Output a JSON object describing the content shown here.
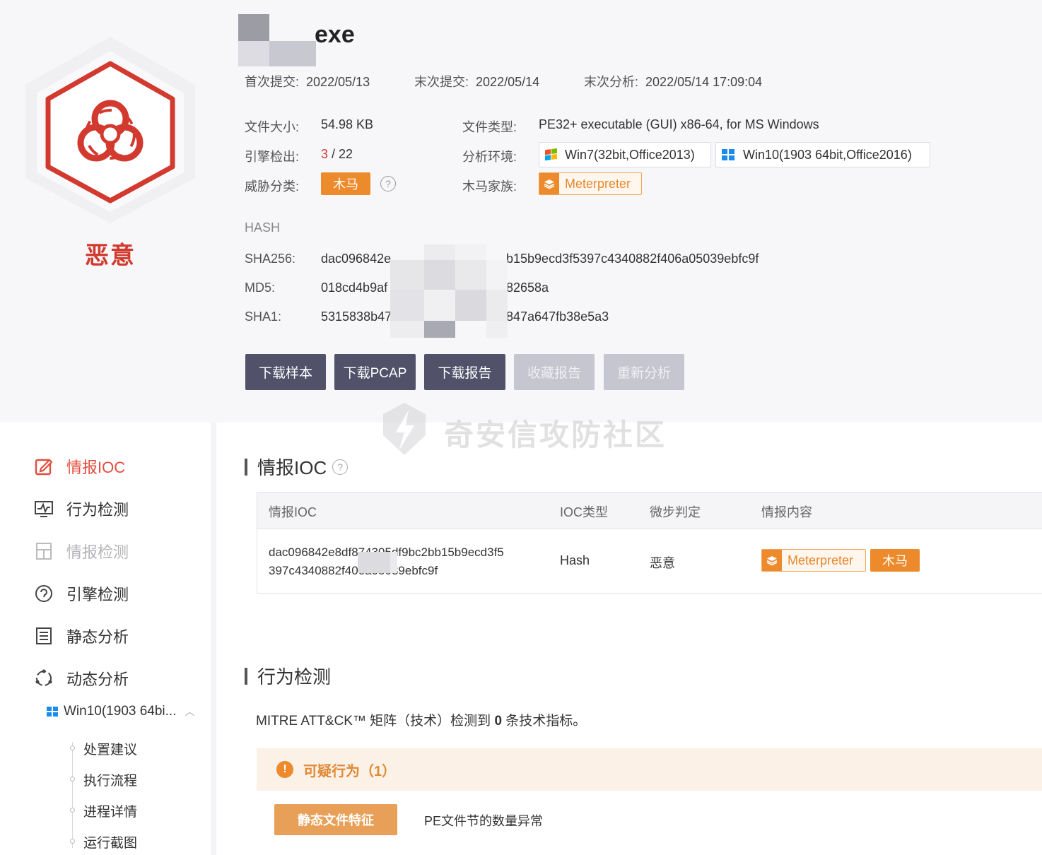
{
  "file": {
    "name_ext": "exe",
    "verdict": "恶意"
  },
  "dates": {
    "first_submit_label": "首次提交:",
    "first_submit_value": "2022/05/13",
    "last_submit_label": "末次提交:",
    "last_submit_value": "2022/05/14",
    "last_analysis_label": "末次分析:",
    "last_analysis_value": "2022/05/14 17:09:04"
  },
  "info": {
    "size_label": "文件大小:",
    "size_value": "54.98 KB",
    "type_label": "文件类型:",
    "type_value": "PE32+ executable (GUI) x86-64, for MS Windows",
    "engine_label": "引擎检出:",
    "engine_hits": "3",
    "engine_total": " / 22",
    "env_label": "分析环境:",
    "env_win7": "Win7(32bit,Office2013)",
    "env_win10": "Win10(1903 64bit,Office2016)",
    "threat_label": "威胁分类:",
    "threat_tag": "木马",
    "family_label": "木马家族:",
    "family_tag": "Meterpreter"
  },
  "hash": {
    "heading": "HASH",
    "sha256_label": "SHA256:",
    "sha256_left": "dac096842e",
    "sha256_right": "b15b9ecd3f5397c4340882f406a05039ebfc9f",
    "md5_label": "MD5:",
    "md5_left": "018cd4b9af",
    "md5_right": "82658a",
    "sha1_label": "SHA1:",
    "sha1_left": "5315838b47",
    "sha1_right": "847a647fb38e5a3"
  },
  "buttons": {
    "download_sample": "下载样本",
    "download_pcap": "下载PCAP",
    "download_report": "下载报告",
    "favorite_report": "收藏报告",
    "reanalyze": "重新分析"
  },
  "watermark": "奇安信攻防社区",
  "sidebar": {
    "items": [
      {
        "label": "情报IOC"
      },
      {
        "label": "行为检测"
      },
      {
        "label": "情报检测"
      },
      {
        "label": "引擎检测"
      },
      {
        "label": "静态分析"
      },
      {
        "label": "动态分析"
      }
    ],
    "sub_group": "Win10(1903 64bi...",
    "sub_items": [
      "处置建议",
      "执行流程",
      "进程详情",
      "运行截图"
    ]
  },
  "ioc": {
    "title": "情报IOC",
    "headers": [
      "情报IOC",
      "IOC类型",
      "微步判定",
      "情报内容"
    ],
    "row": {
      "hash_line1": "dac096842e8df874305df9bc2bb15b9ecd3f5",
      "hash_line2": "397c4340882f406a05039ebfc9f",
      "type": "Hash",
      "verdict": "恶意",
      "family_tag": "Meterpreter",
      "class_tag": "木马"
    }
  },
  "behavior": {
    "title": "行为检测",
    "mitre_prefix": "MITRE ATT&CK™ 矩阵（技术）检测到 ",
    "mitre_count": "0",
    "mitre_suffix": " 条技术指标。",
    "suspicious_label": "可疑行为（1）",
    "static_tag": "静态文件特征",
    "pe_text": "PE文件节的数量异常"
  },
  "colors": {
    "malicious_red": "#d23a2f",
    "orange": "#ec8a2c",
    "dark_button": "#51526a"
  }
}
